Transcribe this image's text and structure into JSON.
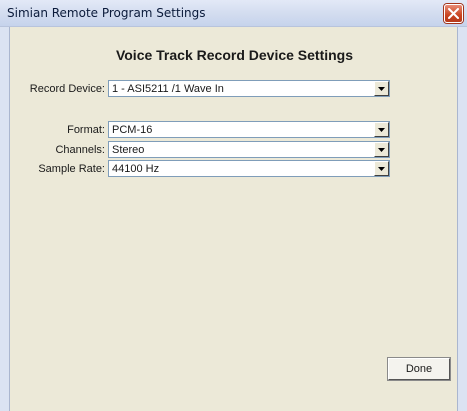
{
  "window": {
    "title": "Simian Remote Program Settings"
  },
  "panel": {
    "heading": "Voice Track Record Device Settings"
  },
  "fields": {
    "record_device": {
      "label": "Record Device:",
      "value": "1 - ASI5211 /1 Wave In"
    },
    "format": {
      "label": "Format:",
      "value": "PCM-16"
    },
    "channels": {
      "label": "Channels:",
      "value": "Stereo"
    },
    "sample_rate": {
      "label": "Sample Rate:",
      "value": "44100 Hz"
    }
  },
  "buttons": {
    "done_label": "Done"
  },
  "icons": {
    "close": "close-icon",
    "dropdown": "chevron-down-icon"
  },
  "colors": {
    "close_button": "#c9441f",
    "window_background": "#ece9d8",
    "field_border": "#7f9db9"
  }
}
